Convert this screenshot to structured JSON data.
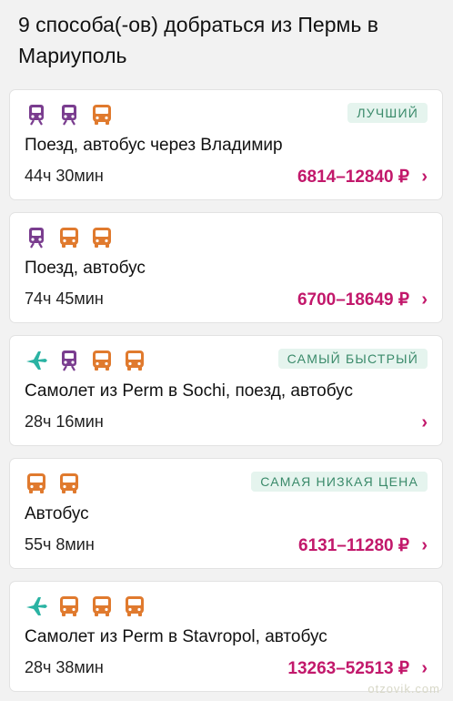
{
  "header": {
    "title": "9 способа(-ов) добраться из Пермь в Мариуполь"
  },
  "colors": {
    "train": "#7a3d8f",
    "bus": "#e07a2e",
    "plane": "#2ab3a3",
    "price": "#c2186b",
    "badge_bg": "#e5f4ee",
    "badge_text": "#3a8a6a"
  },
  "routes": [
    {
      "icons": [
        "train-icon",
        "train-icon",
        "bus-icon"
      ],
      "badge": "ЛУЧШИЙ",
      "title": "Поезд, автобус через Владимир",
      "duration": "44ч 30мин",
      "price": "6814–12840 ₽"
    },
    {
      "icons": [
        "train-icon",
        "bus-icon",
        "bus-icon"
      ],
      "badge": "",
      "title": "Поезд, автобус",
      "duration": "74ч 45мин",
      "price": "6700–18649 ₽"
    },
    {
      "icons": [
        "plane-icon",
        "train-icon",
        "bus-icon",
        "bus-icon"
      ],
      "badge": "САМЫЙ БЫСТРЫЙ",
      "title": "Самолет из Perm в Sochi, поезд, автобус",
      "duration": "28ч 16мин",
      "price": ""
    },
    {
      "icons": [
        "bus-icon",
        "bus-icon"
      ],
      "badge": "САМАЯ НИЗКАЯ ЦЕНА",
      "title": "Автобус",
      "duration": "55ч 8мин",
      "price": "6131–11280 ₽"
    },
    {
      "icons": [
        "plane-icon",
        "bus-icon",
        "bus-icon",
        "bus-icon"
      ],
      "badge": "",
      "title": "Самолет из Perm в Stavropol, автобус",
      "duration": "28ч 38мин",
      "price": "13263–52513 ₽"
    }
  ],
  "chevron": "›",
  "watermark": "otzovik.com"
}
